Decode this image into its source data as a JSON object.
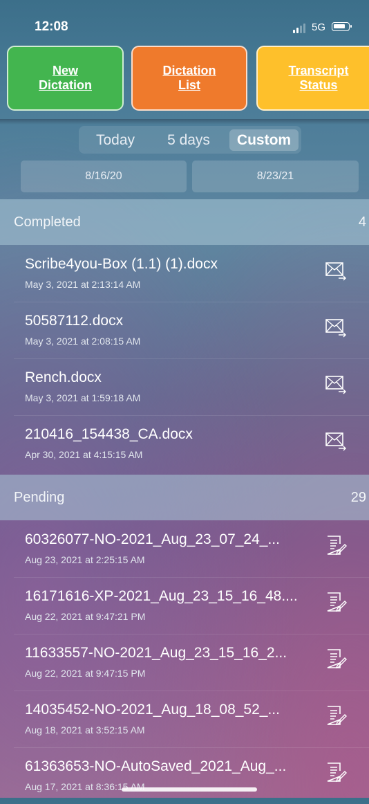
{
  "status_bar": {
    "time": "12:08",
    "network": "5G"
  },
  "actions": {
    "new_dictation": "New\nDictation",
    "dictation_list": "Dictation\nList",
    "transcript_status": "Transcript\nStatus"
  },
  "filter": {
    "segments": [
      "Today",
      "5 days",
      "Custom"
    ],
    "selected": "Custom",
    "from_date": "8/16/20",
    "to_date": "8/23/21"
  },
  "completed": {
    "title": "Completed",
    "count": "4",
    "items": [
      {
        "name": "Scribe4you-Box (1.1) (1).docx",
        "date": "May 3, 2021 at 2:13:14 AM",
        "icon": "email-send-icon"
      },
      {
        "name": "50587112.docx",
        "date": "May 3, 2021 at 2:08:15 AM",
        "icon": "email-send-icon"
      },
      {
        "name": "Rench.docx",
        "date": "May 3, 2021 at 1:59:18 AM",
        "icon": "email-send-icon"
      },
      {
        "name": "210416_154438_CA.docx",
        "date": "Apr 30, 2021 at 4:15:15 AM",
        "icon": "email-send-icon"
      }
    ]
  },
  "pending": {
    "title": "Pending",
    "count": "29",
    "items": [
      {
        "name": "60326077-NO-2021_Aug_23_07_24_...",
        "date": "Aug 23, 2021 at 2:25:15 AM",
        "icon": "edit-document-icon"
      },
      {
        "name": "16171616-XP-2021_Aug_23_15_16_48....",
        "date": "Aug 22, 2021 at 9:47:21 PM",
        "icon": "edit-document-icon"
      },
      {
        "name": "11633557-NO-2021_Aug_23_15_16_2...",
        "date": "Aug 22, 2021 at 9:47:15 PM",
        "icon": "edit-document-icon"
      },
      {
        "name": "14035452-NO-2021_Aug_18_08_52_...",
        "date": "Aug 18, 2021 at 3:52:15 AM",
        "icon": "edit-document-icon"
      },
      {
        "name": "61363653-NO-AutoSaved_2021_Aug_...",
        "date": "Aug 17, 2021 at 8:36:15 AM",
        "icon": "edit-document-icon"
      }
    ]
  },
  "colors": {
    "new_dictation": "#43b54f",
    "dictation_list": "#ef7a2c",
    "transcript_status": "#fec02b"
  }
}
